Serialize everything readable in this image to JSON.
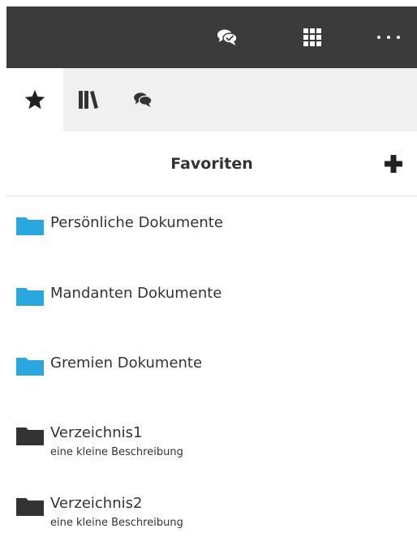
{
  "topbar": {
    "icons": [
      "chat-bubbles-icon",
      "apps-grid-icon",
      "more-dots-icon"
    ],
    "bg_color": "#3b3b3b"
  },
  "tabs": [
    {
      "icon": "star-icon",
      "active": true
    },
    {
      "icon": "library-icon",
      "active": false
    },
    {
      "icon": "chat-bubbles-icon",
      "active": false
    }
  ],
  "panel": {
    "title": "Favoriten",
    "add_icon": "plus-icon"
  },
  "items": [
    {
      "name": "Persönliche Dokumente",
      "description": "",
      "folder_color": "#29a8e0"
    },
    {
      "name": "Mandanten Dokumente",
      "description": "",
      "folder_color": "#29a8e0"
    },
    {
      "name": "Gremien Dokumente",
      "description": "",
      "folder_color": "#29a8e0"
    },
    {
      "name": "Verzeichnis1",
      "description": "eine kleine Beschreibung",
      "folder_color": "#333333"
    },
    {
      "name": "Verzeichnis2",
      "description": "eine kleine Beschreibung",
      "folder_color": "#333333"
    }
  ]
}
